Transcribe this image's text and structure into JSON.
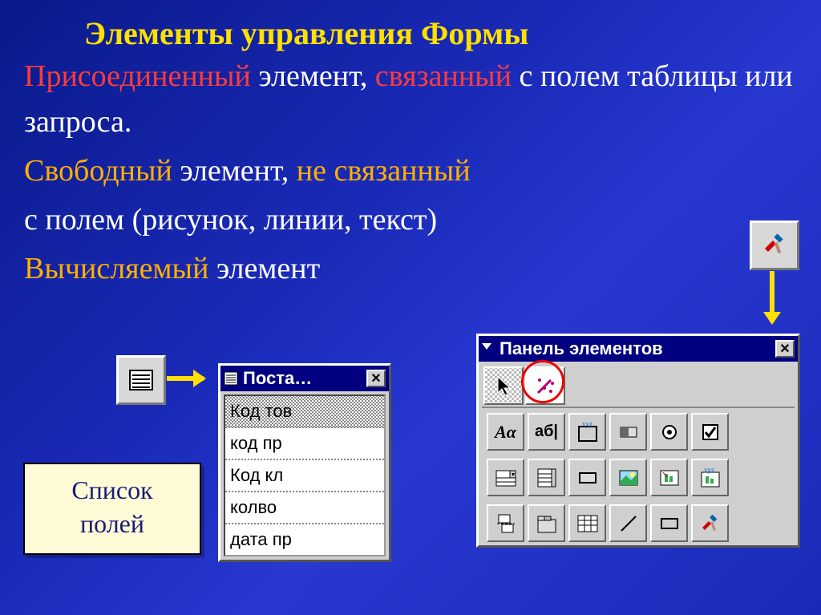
{
  "title": "Элементы управления Формы",
  "lines": {
    "ln1a": "Присоединенный",
    "ln1b": " элемент, ",
    "ln1c": "связанный",
    "ln1d": " с полем таблицы или запроса.",
    "ln2a": "Свободный",
    "ln2b": " элемент, ",
    "ln2c": "не связанный",
    "ln3": "с полем  (рисунок, линии, текст)",
    "ln4": "Вычисляемый",
    "ln4b": " элемент"
  },
  "fieldlist_label": "Список\nполей",
  "fieldlist_window": {
    "title": "Поста…",
    "items": [
      "Код тов",
      "код пр",
      "Код кл",
      "колво",
      "дата пр"
    ]
  },
  "toolbox": {
    "title": "Панель элементов",
    "row1": [
      "cursor",
      "wizard"
    ],
    "row2": [
      "label-Aa",
      "textbox-аб",
      "group-xyz",
      "toggle",
      "option",
      "checkbox"
    ],
    "row3": [
      "combo",
      "listbox",
      "cmdbutton",
      "image",
      "objectframe",
      "boundframe-xyz"
    ],
    "row4": [
      "pagebreak",
      "tab",
      "subform",
      "line",
      "rect",
      "tools"
    ]
  },
  "tools_button": "hammer-tools"
}
